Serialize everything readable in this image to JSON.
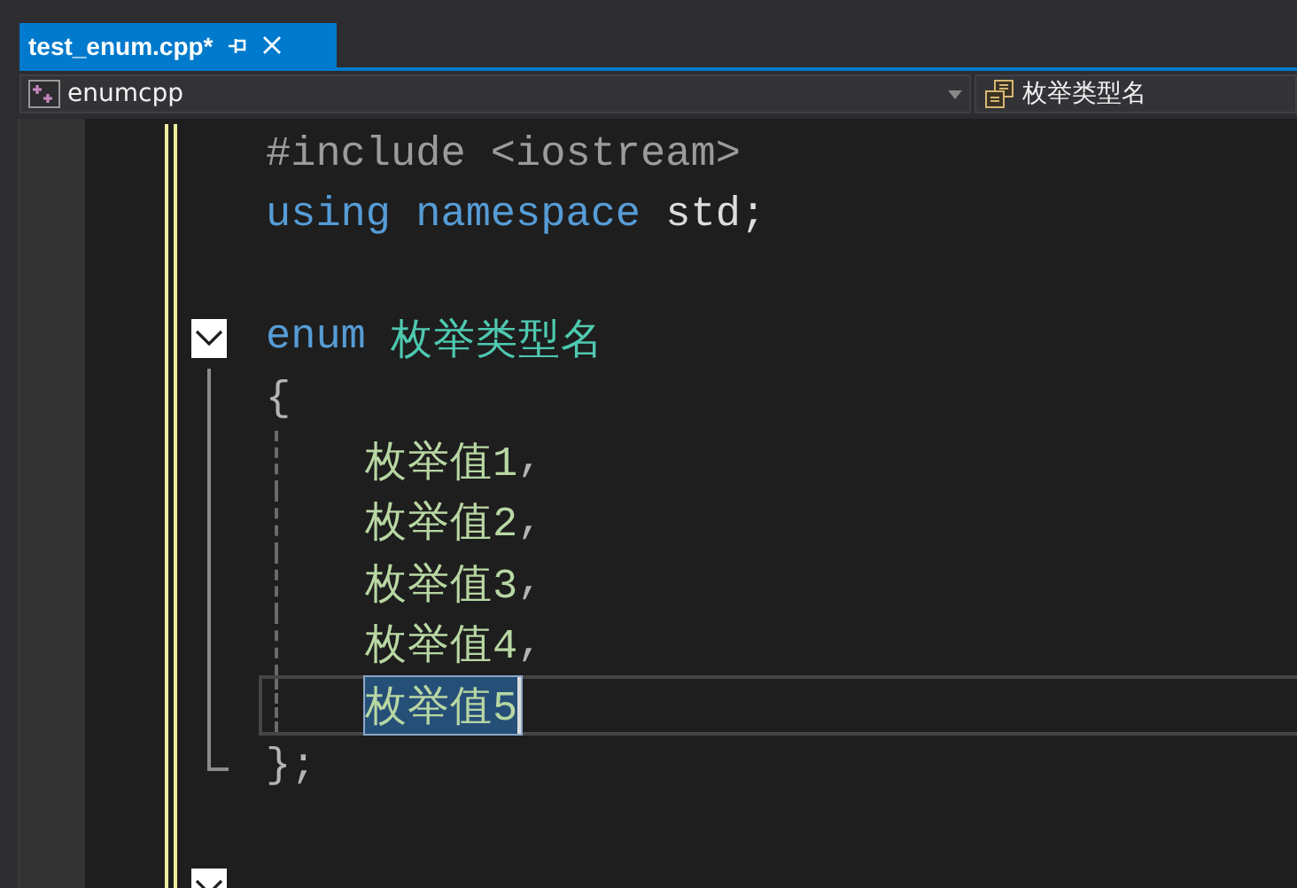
{
  "tab": {
    "title": "test_enum.cpp*",
    "selected": true
  },
  "navigation": {
    "scope": "enumcpp",
    "member": "枚举类型名"
  },
  "editor": {
    "lines": [
      {
        "kind": "plain",
        "tokens": [
          {
            "kind": "preprocessor",
            "text": "#include <iostream>"
          }
        ],
        "indented": false,
        "changed": true,
        "current": false
      },
      {
        "kind": "plain",
        "tokens": [
          {
            "kind": "keyword",
            "text": "using namespace "
          },
          {
            "kind": "plain",
            "text": "std;"
          }
        ],
        "indented": false,
        "changed": true,
        "current": false
      },
      {
        "kind": "plain",
        "indented": false,
        "changed": true,
        "current": false
      },
      {
        "kind": "fold-start",
        "tokens": [
          {
            "kind": "keyword",
            "text": "enum "
          },
          {
            "kind": "type",
            "text": "枚举类型名"
          }
        ],
        "indented": false,
        "changed": true,
        "current": false
      },
      {
        "kind": "fold-body",
        "tokens": [
          {
            "kind": "punctuation",
            "text": "{"
          }
        ],
        "indented": false,
        "changed": true,
        "current": false
      },
      {
        "kind": "fold-body",
        "tokens": [
          {
            "kind": "enumerator",
            "text": "枚举值1"
          },
          {
            "kind": "punctuation",
            "text": ","
          }
        ],
        "indented": true,
        "changed": true,
        "current": false
      },
      {
        "kind": "fold-body",
        "tokens": [
          {
            "kind": "enumerator",
            "text": "枚举值2"
          },
          {
            "kind": "punctuation",
            "text": ","
          }
        ],
        "indented": true,
        "changed": true,
        "current": false
      },
      {
        "kind": "fold-body",
        "tokens": [
          {
            "kind": "enumerator",
            "text": "枚举值3"
          },
          {
            "kind": "punctuation",
            "text": ","
          }
        ],
        "indented": true,
        "changed": true,
        "current": false
      },
      {
        "kind": "fold-body",
        "tokens": [
          {
            "kind": "enumerator",
            "text": "枚举值4"
          },
          {
            "kind": "punctuation",
            "text": ","
          }
        ],
        "indented": true,
        "changed": true,
        "current": false
      },
      {
        "kind": "fold-body",
        "tokens": [
          {
            "kind": "enumerator",
            "text": "枚举值5",
            "selected": true
          }
        ],
        "indented": true,
        "changed": true,
        "current": true
      },
      {
        "kind": "fold-end",
        "tokens": [
          {
            "kind": "punctuation",
            "text": "};"
          }
        ],
        "indented": false,
        "changed": true,
        "current": false
      },
      {
        "kind": "plain",
        "indented": false,
        "changed": true,
        "current": false
      },
      {
        "kind": "fold-start",
        "indented": false,
        "changed": true,
        "current": false
      }
    ]
  }
}
